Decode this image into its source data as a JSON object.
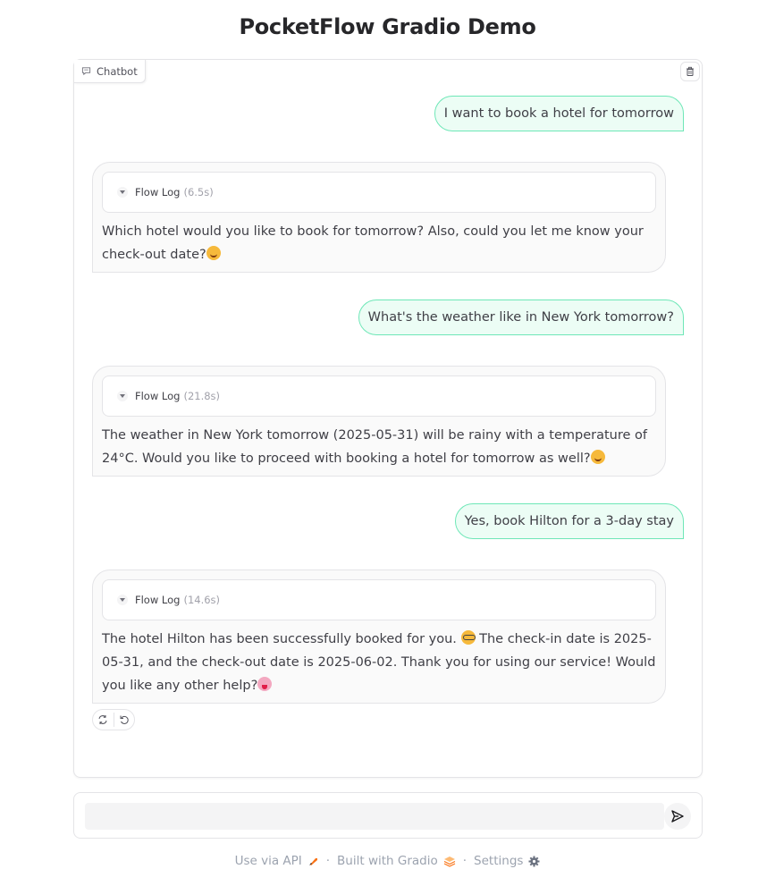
{
  "page": {
    "title": "PocketFlow Gradio Demo"
  },
  "chatbot": {
    "label": "Chatbot",
    "messages": [
      {
        "role": "user",
        "text": "I want to book a hotel for tomorrow"
      },
      {
        "role": "assistant",
        "log_label": "Flow Log",
        "log_duration": "(6.5s)",
        "text": "Which hotel would you like to book for tomorrow? Also, could you let me know your check-out date?",
        "emoji": "smiling-face"
      },
      {
        "role": "user",
        "text": "What's the weather like in New York tomorrow?"
      },
      {
        "role": "assistant",
        "log_label": "Flow Log",
        "log_duration": "(21.8s)",
        "text": "The weather in New York tomorrow (2025-05-31) will be rainy with a temperature of 24°C. Would you like to proceed with booking a hotel for tomorrow as well?",
        "emoji": "smiling-face"
      },
      {
        "role": "user",
        "text": "Yes, book Hilton for a 3-day stay"
      },
      {
        "role": "assistant",
        "log_label": "Flow Log",
        "log_duration": "(14.6s)",
        "text_part1": "The hotel Hilton has been successfully booked for you.",
        "text_part2": "The check-in date is 2025-05-31, and the check-out date is 2025-06-02. Thank you for using our service! Would you like any other help?",
        "emoji_inline": "face-with-glasses",
        "emoji": "face-with-tongue"
      }
    ]
  },
  "input": {
    "value": "",
    "placeholder": ""
  },
  "footer": {
    "api_label": "Use via API",
    "built_label": "Built with Gradio",
    "settings_label": "Settings",
    "separator": "·"
  },
  "colors": {
    "user_bubble_bg": "#ecfdf5",
    "user_bubble_border": "#6ee7b7",
    "bot_bubble_bg": "#fafafa",
    "border": "#e4e4e7"
  }
}
